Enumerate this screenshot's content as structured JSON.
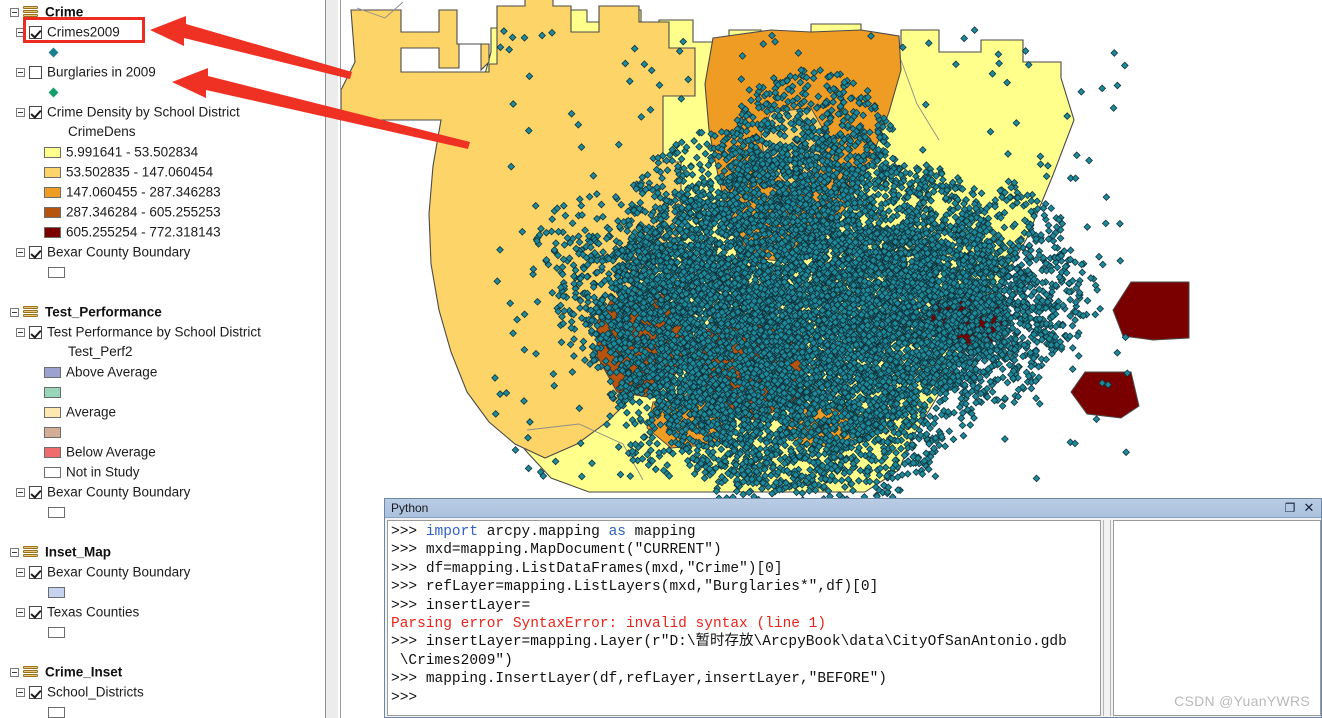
{
  "toc": {
    "groups": [
      {
        "name": "Crime",
        "icon": "layer-group-icon",
        "layers": [
          {
            "name": "Crimes2009",
            "checked": true,
            "symbol": {
              "type": "point-diamond",
              "color": "#1a7f8e"
            }
          },
          {
            "name": "Burglaries in 2009",
            "checked": false,
            "symbol": {
              "type": "point-diamond",
              "color": "#11a06a"
            }
          },
          {
            "name": "Crime Density by School District",
            "checked": true,
            "field": "CrimeDens",
            "classes": [
              {
                "label": "5.991641 - 53.502834",
                "color": "#ffff8c"
              },
              {
                "label": "53.502835 - 147.060454",
                "color": "#fcd467"
              },
              {
                "label": "147.060455 - 287.346283",
                "color": "#ef9c25"
              },
              {
                "label": "287.346284 - 605.255253",
                "color": "#b5530f"
              },
              {
                "label": "605.255254 - 772.318143",
                "color": "#7a0000"
              }
            ]
          },
          {
            "name": "Bexar County Boundary",
            "checked": true,
            "symbol": {
              "type": "polygon",
              "color": "#ffffff"
            }
          }
        ]
      },
      {
        "name": "Test_Performance",
        "icon": "layer-group-icon",
        "layers": [
          {
            "name": "Test Performance by School District",
            "checked": true,
            "field": "Test_Perf2",
            "classes": [
              {
                "label": "Above Average",
                "color": "#9ba2d0"
              },
              {
                "label": "",
                "color": "#97d6b8"
              },
              {
                "label": "Average",
                "color": "#fce8b0"
              },
              {
                "label": "",
                "color": "#d4ad96"
              },
              {
                "label": "Below Average",
                "color": "#f06b6b"
              },
              {
                "label": "Not in Study",
                "color": "#ffffff"
              }
            ]
          },
          {
            "name": "Bexar County Boundary",
            "checked": true,
            "symbol": {
              "type": "polygon",
              "color": "#ffffff"
            }
          }
        ]
      },
      {
        "name": "Inset_Map",
        "icon": "layer-group-icon",
        "layers": [
          {
            "name": "Bexar County Boundary",
            "checked": true,
            "symbol": {
              "type": "polygon",
              "color": "#c5d3ef"
            }
          },
          {
            "name": "Texas Counties",
            "checked": true,
            "symbol": {
              "type": "polygon",
              "color": "#ffffff"
            }
          }
        ]
      },
      {
        "name": "Crime_Inset",
        "icon": "layer-group-icon",
        "layers": [
          {
            "name": "School_Districts",
            "checked": true,
            "symbol": {
              "type": "polygon",
              "color": "#ffffff"
            }
          }
        ]
      }
    ]
  },
  "python_window": {
    "title": "Python",
    "maximize_label": "❐",
    "close_label": "✕",
    "lines": [
      {
        "prompt": ">>> ",
        "segments": [
          {
            "text": "import",
            "style": "kw"
          },
          {
            "text": " arcpy.mapping ",
            "style": "plain"
          },
          {
            "text": "as",
            "style": "kw"
          },
          {
            "text": " mapping",
            "style": "plain"
          }
        ]
      },
      {
        "prompt": ">>> ",
        "segments": [
          {
            "text": "mxd=mapping.MapDocument(\"CURRENT\")",
            "style": "plain"
          }
        ]
      },
      {
        "prompt": ">>> ",
        "segments": [
          {
            "text": "df=mapping.ListDataFrames(mxd,\"Crime\")[0]",
            "style": "plain"
          }
        ]
      },
      {
        "prompt": ">>> ",
        "segments": [
          {
            "text": "refLayer=mapping.ListLayers(mxd,\"Burglaries*\",df)[0]",
            "style": "plain"
          }
        ]
      },
      {
        "prompt": ">>> ",
        "segments": [
          {
            "text": "insertLayer=",
            "style": "plain"
          }
        ]
      },
      {
        "prompt": "",
        "segments": [
          {
            "text": "Parsing error SyntaxError: invalid syntax (line 1)",
            "style": "err"
          }
        ]
      },
      {
        "prompt": ">>> ",
        "segments": [
          {
            "text": "insertLayer=mapping.Layer(r\"D:\\暂时存放\\ArcpyBook\\data\\CityOfSanAntonio.gdb",
            "style": "plain"
          }
        ]
      },
      {
        "prompt": " ",
        "segments": [
          {
            "text": "\\Crimes2009\")",
            "style": "plain"
          }
        ]
      },
      {
        "prompt": ">>> ",
        "segments": [
          {
            "text": "mapping.InsertLayer(df,refLayer,insertLayer,\"BEFORE\")",
            "style": "plain"
          }
        ]
      },
      {
        "prompt": ">>> ",
        "segments": [
          {
            "text": "",
            "style": "plain"
          }
        ]
      }
    ]
  },
  "watermark": {
    "text": "CSDN @YuanYWRS"
  },
  "annotations": {
    "highlight_color": "#ee2b21",
    "arrow_color": "#ef3124",
    "highlight_target": "Crimes2009",
    "arrows": [
      {
        "name": "arrow-to-crimes2009",
        "target": "Crimes2009"
      },
      {
        "name": "arrow-to-burglaries-2009",
        "target": "Burglaries in 2009"
      }
    ]
  },
  "map": {
    "name": "crime-density-map",
    "point_symbol_color": "#1d8a9b",
    "point_symbol_outline": "#11333b",
    "density_colors": [
      "#ffff8c",
      "#fcd467",
      "#ef9c25",
      "#b5530f",
      "#7a0000"
    ],
    "background": "#ffffff",
    "boundary_color": "#3b3b3b"
  }
}
